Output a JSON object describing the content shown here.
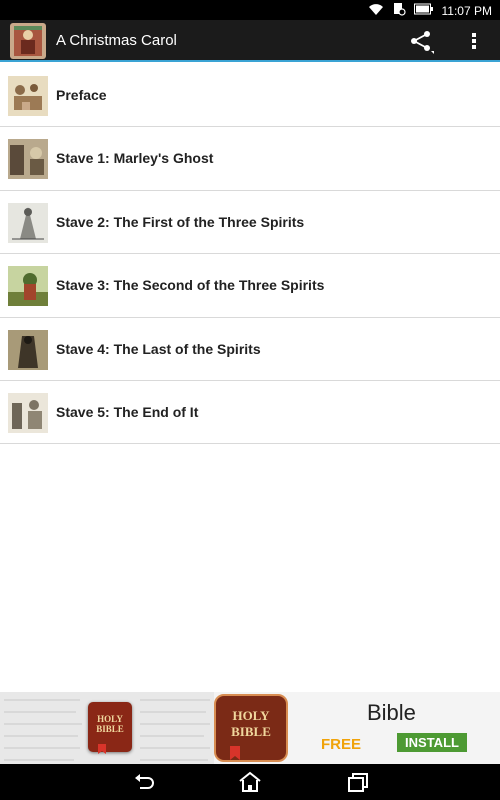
{
  "status_bar": {
    "time": "11:07 PM",
    "icons": [
      "wifi-icon",
      "notification-icon",
      "battery-icon"
    ]
  },
  "action_bar": {
    "title": "A Christmas Carol",
    "actions": [
      "share-icon",
      "overflow-menu-icon"
    ]
  },
  "chapters": [
    {
      "label": "Preface"
    },
    {
      "label": "Stave 1: Marley's Ghost"
    },
    {
      "label": "Stave 2: The First of the Three Spirits"
    },
    {
      "label": "Stave 3: The Second of the Three Spirits"
    },
    {
      "label": "Stave 4: The Last of the Spirits"
    },
    {
      "label": "Stave 5: The End of It"
    }
  ],
  "ad": {
    "small_book_line1": "HOLY",
    "small_book_line2": "BIBLE",
    "icon_line1": "HOLY",
    "icon_line2": "BIBLE",
    "title": "Bible",
    "price": "FREE",
    "install_label": "INSTALL"
  },
  "nav_bar": {
    "buttons": [
      "back-icon",
      "home-icon",
      "recent-apps-icon"
    ]
  },
  "colors": {
    "action_bar_bg": "#1b1b1b",
    "accent_line": "#3aa3d4",
    "install_green": "#4d9a33",
    "free_orange": "#f0a30a"
  }
}
